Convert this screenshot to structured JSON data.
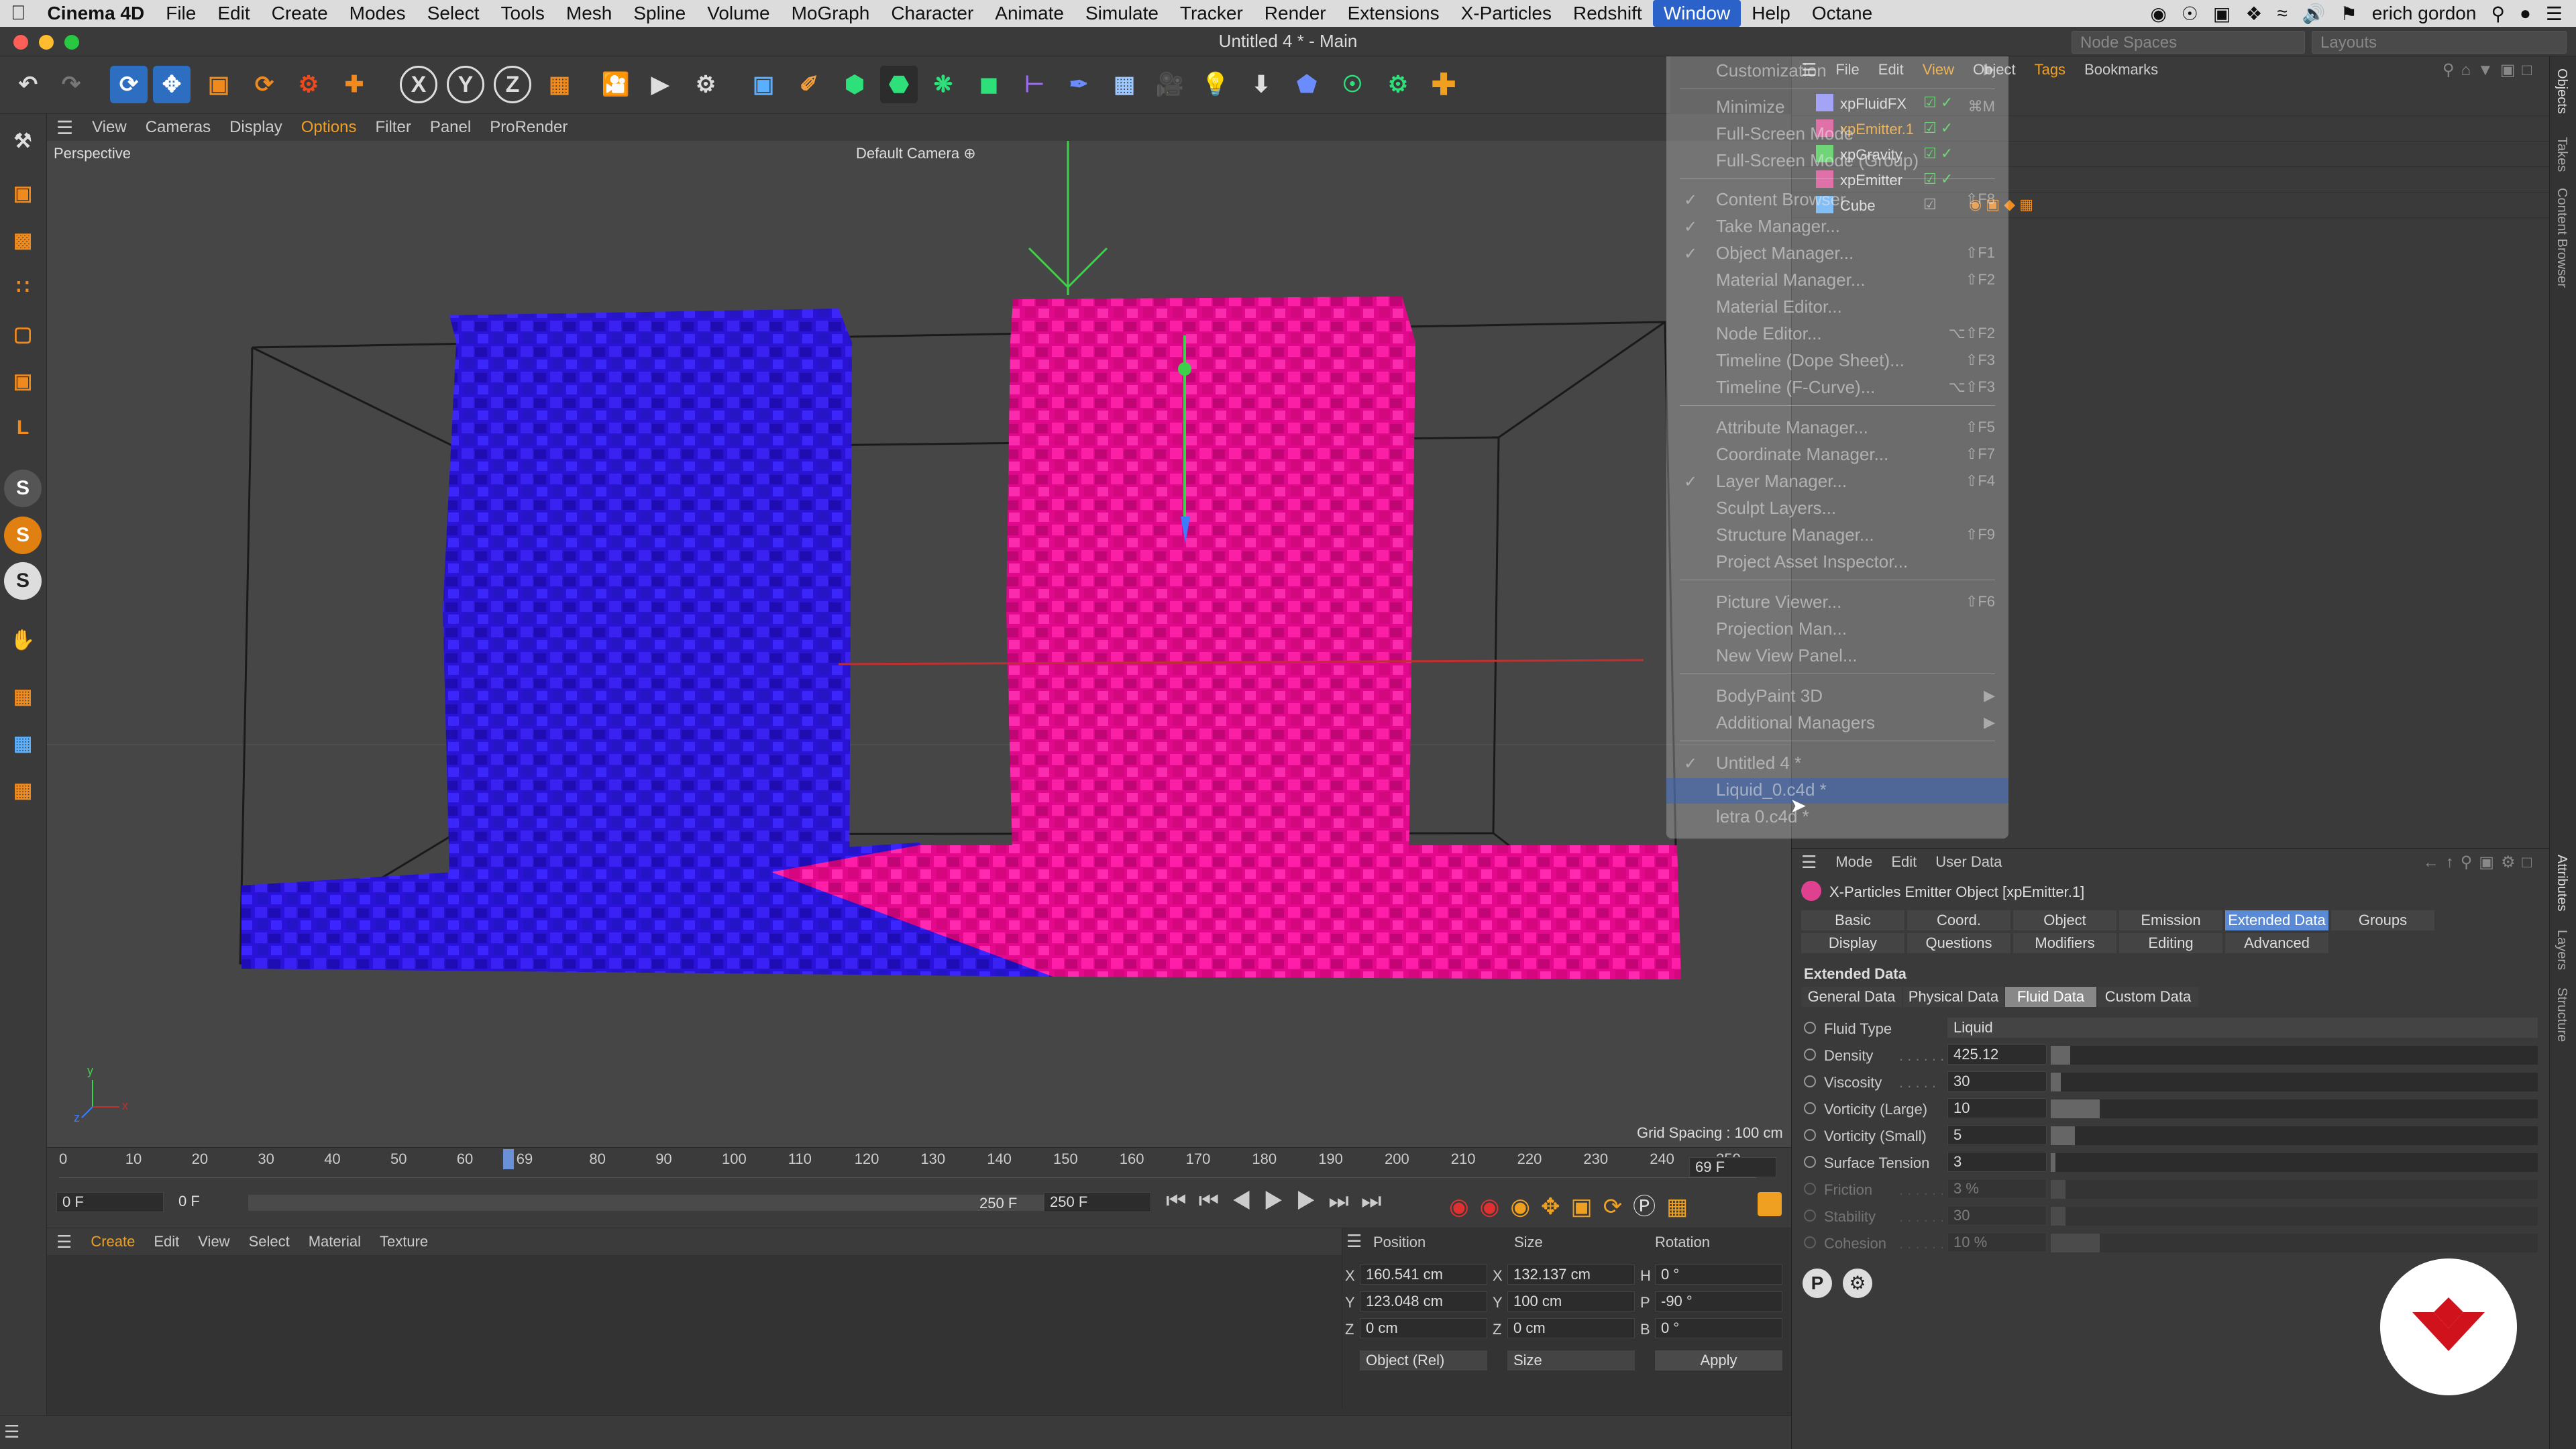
{
  "menubar": {
    "app": "Cinema 4D",
    "items": [
      "File",
      "Edit",
      "Create",
      "Modes",
      "Select",
      "Tools",
      "Mesh",
      "Spline",
      "Volume",
      "MoGraph",
      "Character",
      "Animate",
      "Simulate",
      "Tracker",
      "Render",
      "Extensions",
      "X-Particles",
      "Redshift",
      "Window",
      "Help",
      "Octane"
    ],
    "active": "Window",
    "user": "erich gordon"
  },
  "window": {
    "title": "Untitled 4 * - Main",
    "node_spaces": "Node Spaces",
    "layouts": "Layouts"
  },
  "viewport_menu": [
    "View",
    "Cameras",
    "Display",
    "Options",
    "Filter",
    "Panel",
    "ProRender"
  ],
  "viewport": {
    "label": "Perspective",
    "camera": "Default Camera",
    "grid_spacing": "Grid Spacing : 100 cm",
    "colors": {
      "blue": "#2f17e6",
      "pink": "#ef0a95"
    }
  },
  "timeline": {
    "ticks": [
      "0",
      "10",
      "20",
      "30",
      "40",
      "50",
      "60",
      "69",
      "80",
      "90",
      "100",
      "110",
      "120",
      "130",
      "140",
      "150",
      "160",
      "170",
      "180",
      "190",
      "200",
      "210",
      "220",
      "230",
      "240",
      "250"
    ],
    "current_frame": "69 F",
    "start": "0 F",
    "range_start": "0 F",
    "range_end": "250 F",
    "end": "250 F"
  },
  "material_manager": {
    "menu": [
      "Create",
      "Edit",
      "View",
      "Select",
      "Material",
      "Texture"
    ]
  },
  "coordinates": {
    "headers": {
      "position": "Position",
      "size": "Size",
      "rotation": "Rotation"
    },
    "rows": [
      {
        "axis": "X",
        "pos": "160.541 cm",
        "size_axis": "X",
        "size": "132.137 cm",
        "rot_axis": "H",
        "rot": "0 °"
      },
      {
        "axis": "Y",
        "pos": "123.048 cm",
        "size_axis": "Y",
        "size": "100 cm",
        "rot_axis": "P",
        "rot": "-90 °"
      },
      {
        "axis": "Z",
        "pos": "0 cm",
        "size_axis": "Z",
        "size": "0 cm",
        "rot_axis": "B",
        "rot": "0 °"
      }
    ],
    "mode": "Object (Rel)",
    "size_mode": "Size",
    "apply": "Apply"
  },
  "object_manager": {
    "menu": [
      "File",
      "Edit",
      "View",
      "Object",
      "Tags",
      "Bookmarks"
    ],
    "objects": [
      {
        "name": "xpFluidFX",
        "selected": false
      },
      {
        "name": "xpEmitter.1",
        "selected": true
      },
      {
        "name": "xpGravity",
        "selected": false
      },
      {
        "name": "xpEmitter",
        "selected": false
      },
      {
        "name": "Cube",
        "selected": false
      }
    ]
  },
  "window_menu": {
    "items": [
      {
        "label": "Customization",
        "key": "",
        "check": false,
        "arrow": true
      },
      {
        "label": "Minimize",
        "key": "⌘M",
        "check": false
      },
      {
        "label": "Full-Screen Mode",
        "key": "",
        "check": false
      },
      {
        "label": "Full-Screen Mode (Group)",
        "key": "",
        "check": false
      },
      {
        "label": "Content Browser...",
        "key": "⇧F8",
        "check": true
      },
      {
        "label": "Take Manager...",
        "key": "",
        "check": true
      },
      {
        "label": "Object Manager...",
        "key": "⇧F1",
        "check": true
      },
      {
        "label": "Material Manager...",
        "key": "⇧F2",
        "check": false
      },
      {
        "label": "Material Editor...",
        "key": "",
        "check": false
      },
      {
        "label": "Node Editor...",
        "key": "⌥⇧F2",
        "check": false
      },
      {
        "label": "Timeline (Dope Sheet)...",
        "key": "⇧F3",
        "check": false
      },
      {
        "label": "Timeline (F-Curve)...",
        "key": "⌥⇧F3",
        "check": false
      },
      {
        "label": "Attribute Manager...",
        "key": "⇧F5",
        "check": false
      },
      {
        "label": "Coordinate Manager...",
        "key": "⇧F7",
        "check": false
      },
      {
        "label": "Layer Manager...",
        "key": "⇧F4",
        "check": true
      },
      {
        "label": "Sculpt Layers...",
        "key": "",
        "check": false
      },
      {
        "label": "Structure Manager...",
        "key": "⇧F9",
        "check": false
      },
      {
        "label": "Project Asset Inspector...",
        "key": "",
        "check": false
      },
      {
        "label": "Picture Viewer...",
        "key": "⇧F6",
        "check": false
      },
      {
        "label": "Projection Man...",
        "key": "",
        "check": false
      },
      {
        "label": "New View Panel...",
        "key": "",
        "check": false
      },
      {
        "label": "BodyPaint 3D",
        "key": "",
        "check": false,
        "arrow": true
      },
      {
        "label": "Additional Managers",
        "key": "",
        "check": false,
        "arrow": true
      },
      {
        "label": "Untitled 4 *",
        "key": "",
        "check": true
      },
      {
        "label": "Liquid_0.c4d *",
        "key": "",
        "check": false,
        "highlight": true
      },
      {
        "label": "letra 0.c4d *",
        "key": "",
        "check": false
      }
    ]
  },
  "attributes": {
    "menu": [
      "Mode",
      "Edit",
      "User Data"
    ],
    "object_title": "X-Particles Emitter Object [xpEmitter.1]",
    "tabs_row1": [
      "Basic",
      "Coord.",
      "Object",
      "Emission",
      "Extended Data",
      "Groups"
    ],
    "tabs_row2": [
      "Display",
      "Questions",
      "Modifiers",
      "Editing",
      "Advanced"
    ],
    "active_tab": "Extended Data",
    "section": "Extended Data",
    "subtabs": [
      "General Data",
      "Physical Data",
      "Fluid Data",
      "Custom Data"
    ],
    "active_subtab": "Fluid Data",
    "params": [
      {
        "label": "Fluid Type",
        "dots": "",
        "value": "Liquid",
        "dropdown": true,
        "enabled": true
      },
      {
        "label": "Density",
        "dots": " . . . . . . ",
        "value": "425.12",
        "slider": 0.04,
        "enabled": true
      },
      {
        "label": "Viscosity",
        "dots": " . . . . . ",
        "value": "30",
        "slider": 0.02,
        "enabled": true
      },
      {
        "label": "Vorticity (Large)",
        "dots": "",
        "value": "10",
        "slider": 0.1,
        "enabled": true
      },
      {
        "label": "Vorticity (Small)",
        "dots": "",
        "value": "5",
        "slider": 0.05,
        "enabled": true
      },
      {
        "label": "Surface Tension",
        "dots": "",
        "value": "3",
        "slider": 0.01,
        "enabled": true
      },
      {
        "label": "Friction",
        "dots": " . . . . . . ",
        "value": "3 %",
        "slider": 0.03,
        "enabled": false
      },
      {
        "label": "Stability",
        "dots": " . . . . . . ",
        "value": "30",
        "slider": 0.03,
        "enabled": false
      },
      {
        "label": "Cohesion",
        "dots": " . . . . . . ",
        "value": "10 %",
        "slider": 0.1,
        "enabled": false
      }
    ]
  },
  "side_tabs": [
    "Objects",
    "Takes",
    "Content Browser",
    "Attributes",
    "Layers",
    "Structure"
  ]
}
